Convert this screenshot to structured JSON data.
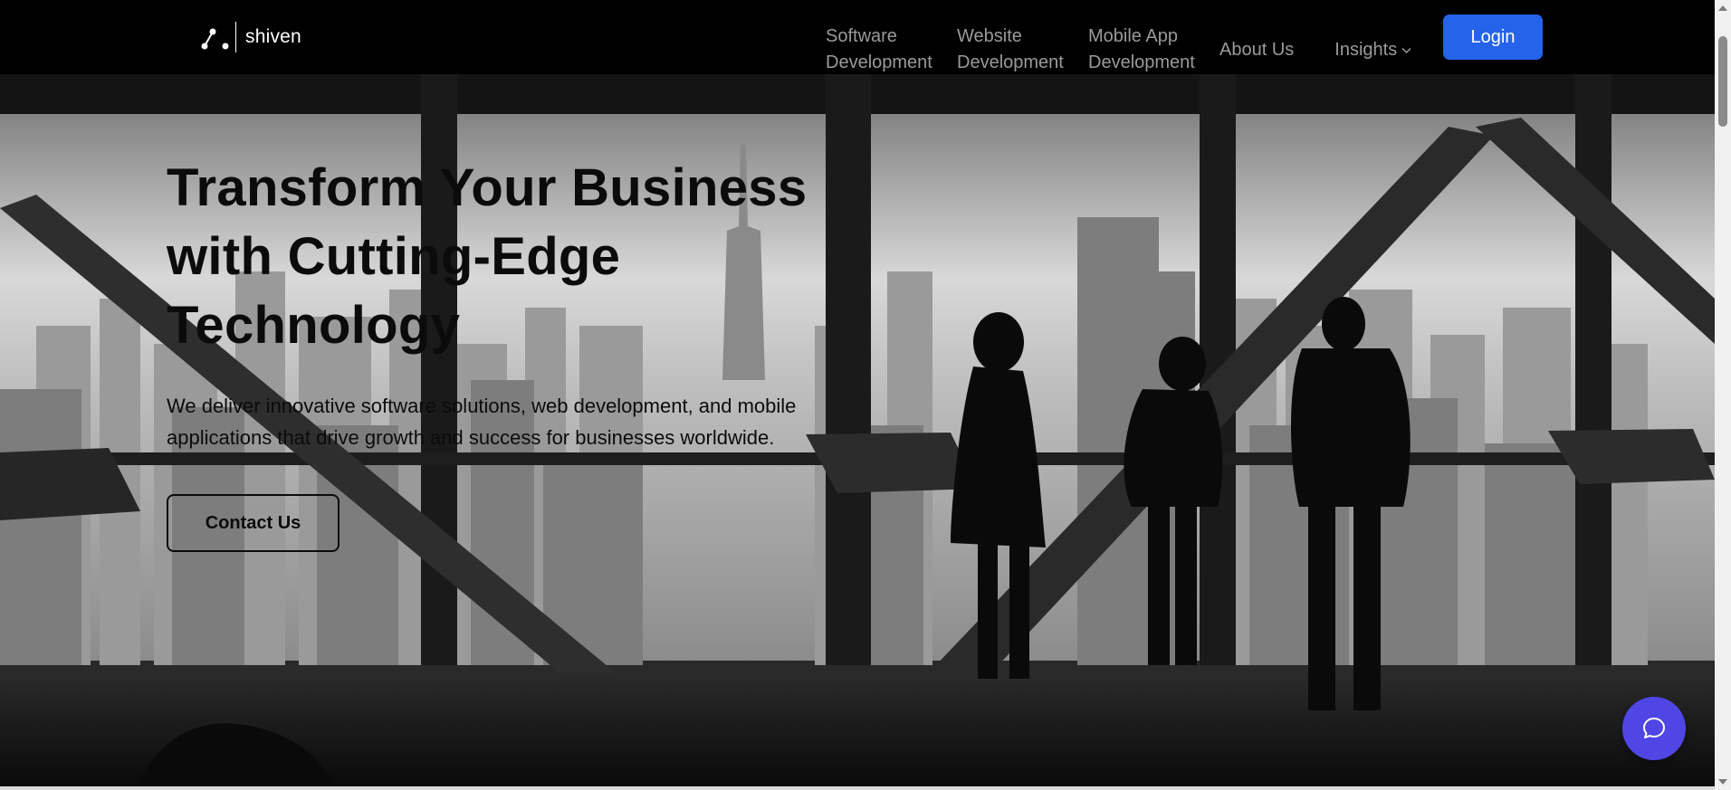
{
  "brand": {
    "name": "shiven"
  },
  "nav": {
    "items": [
      {
        "label": "Software Development"
      },
      {
        "label": "Website Development"
      },
      {
        "label": "Mobile App Development"
      },
      {
        "label": "About Us"
      },
      {
        "label": "Insights"
      }
    ],
    "login_label": "Login"
  },
  "hero": {
    "title": "Transform Your Business with Cutting-Edge Technology",
    "subtitle": "We deliver innovative software solutions, web development, and mobile applications that drive growth and success for businesses worldwide.",
    "cta_label": "Contact Us"
  },
  "icons": {
    "brand": "logo-mark-icon",
    "insights": "chevron-down-icon",
    "chat": "chat-bubble-icon"
  },
  "colors": {
    "navbar_bg": "#000000",
    "login_bg": "#2563eb",
    "chat_bg": "#4f46e5"
  }
}
